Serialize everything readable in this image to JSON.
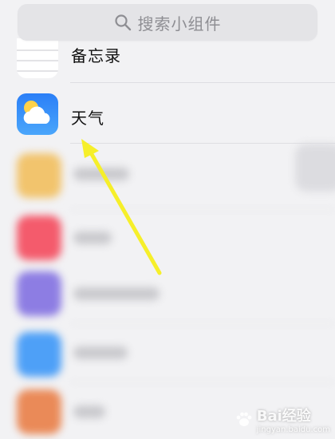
{
  "search": {
    "placeholder": "搜索小组件"
  },
  "widgets": [
    {
      "label": "备忘录",
      "icon": "memo-icon"
    },
    {
      "label": "天气",
      "icon": "weather-icon"
    }
  ],
  "watermark": {
    "text": "Bai经验",
    "sub": "jingyan.baidu.com"
  },
  "colors": {
    "arrow": "#f6ef2a",
    "weather_bg": "#2b7ff7"
  }
}
